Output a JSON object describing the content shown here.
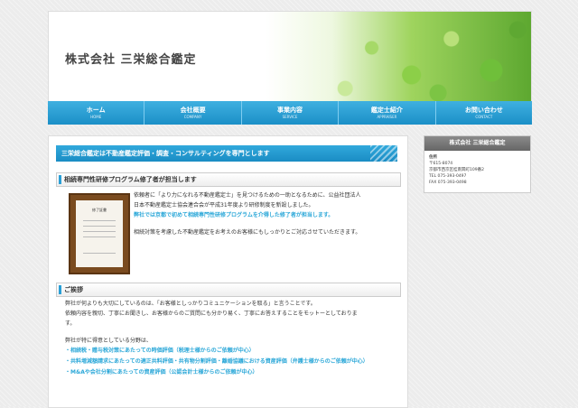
{
  "header": {
    "site_title": "株式会社 三栄総合鑑定"
  },
  "nav": [
    {
      "jp": "ホーム",
      "en": "HOME"
    },
    {
      "jp": "会社概要",
      "en": "COMPANY"
    },
    {
      "jp": "事業内容",
      "en": "SERVICE"
    },
    {
      "jp": "鑑定士紹介",
      "en": "APPRAISER"
    },
    {
      "jp": "お問い合わせ",
      "en": "CONTACT"
    }
  ],
  "main": {
    "banner": "三栄総合鑑定は不動産鑑定評価・調査・コンサルティングを専門とします",
    "section1": {
      "heading": "相続専門性研修プログラム修了者が担当します",
      "certificate_title": "修了証書",
      "p1": "依頼者に「より力になれる不動産鑑定士」を見つけるための一助となるために、公益社団法人",
      "p2": "日本不動産鑑定士協会連合会が平成31年度より研修制度を新設しました。",
      "p3": "弊社では京都で初めて相続専門性研修プログラムを介得した修了者が担当します。",
      "p4": "相続対策を考慮した不動産鑑定をお考えのお客様にもしっかりとご対応させていただきます。"
    },
    "section2": {
      "heading": "ご挨拶",
      "p1": "弊社が何よりも大切にしているのは、「お客様としっかりコミュニケーションを取る」と言うことです。",
      "p2": "依頼内容を親切、丁寧にお聞きし、お客様からのご質問にも分かり易く、丁寧にお答えすることをモットーとしておりま",
      "p3": "す。",
      "p4": "弊社が特に得意としている分野は、",
      "list": [
        "・相続税・贈与税対策にあたっての時価評価（税理士様からのご依頼が中心）",
        "・共料増減額請求にあたっての適正共料評価・共有物分割評価・離婚協議における資産評価（弁護士様からのご依頼が中心）",
        "・M&Aや会社分割にあたっての資産評価（公認会計士様からのご依頼が中心）"
      ]
    }
  },
  "sidebar": {
    "title": "株式会社 三栄総合鑑定",
    "address_label": "住所",
    "postal": "〒615-8074",
    "address": "京都市西京区桂南巽町109番2",
    "tel": "TEL 075-393-0497",
    "fax": "FAX 075-393-0498"
  }
}
